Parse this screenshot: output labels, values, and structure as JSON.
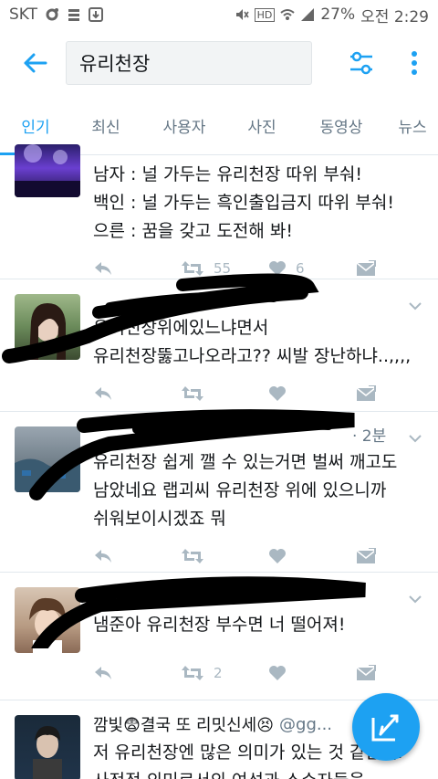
{
  "status": {
    "carrier": "SKT",
    "battery": "27%",
    "time": "오전 2:29",
    "hd_label": "HD"
  },
  "search": {
    "query": "유리천장"
  },
  "tabs": [
    "인기",
    "최신",
    "사용자",
    "사진",
    "동영상",
    "뉴스"
  ],
  "tweets": [
    {
      "lines": [
        "남자 : 널 가두는 유리천장 따위 부숴!",
        "백인 : 널 가두는 흑인출입금지 따위 부숴!",
        "으른 : 꿈을 갖고 도전해 봐!"
      ],
      "retweets": "55",
      "likes": "6"
    },
    {
      "lines": [
        "유리천장위에있느냐면서",
        "유리천장뚫고나오라고?? 씨발 장난하냐..,,,,"
      ],
      "retweets": "",
      "likes": ""
    },
    {
      "time": "· 2분",
      "lines": [
        "유리천장 쉽게 깰 수 있는거면 벌써 깨고도",
        "남았네요 랩괴씨 유리천장 위에 있으니까",
        "쉬워보이시겠죠 뭐"
      ],
      "retweets": "",
      "likes": ""
    },
    {
      "lines": [
        "냄준아 유리천장 부수면 너 떨어져!"
      ],
      "retweets": "2",
      "likes": ""
    },
    {
      "name": "깜빛😨결국 또 리밋신세😣",
      "handle": "@gg...",
      "lines": [
        "저 유리천장엔 많은 의미가 있는 것 같은데.",
        "사전적 의미로서의 여성과 소수자들을"
      ]
    }
  ],
  "colors": {
    "accent": "#1da1f2",
    "muted": "#aab8c2",
    "text": "#14171a"
  }
}
